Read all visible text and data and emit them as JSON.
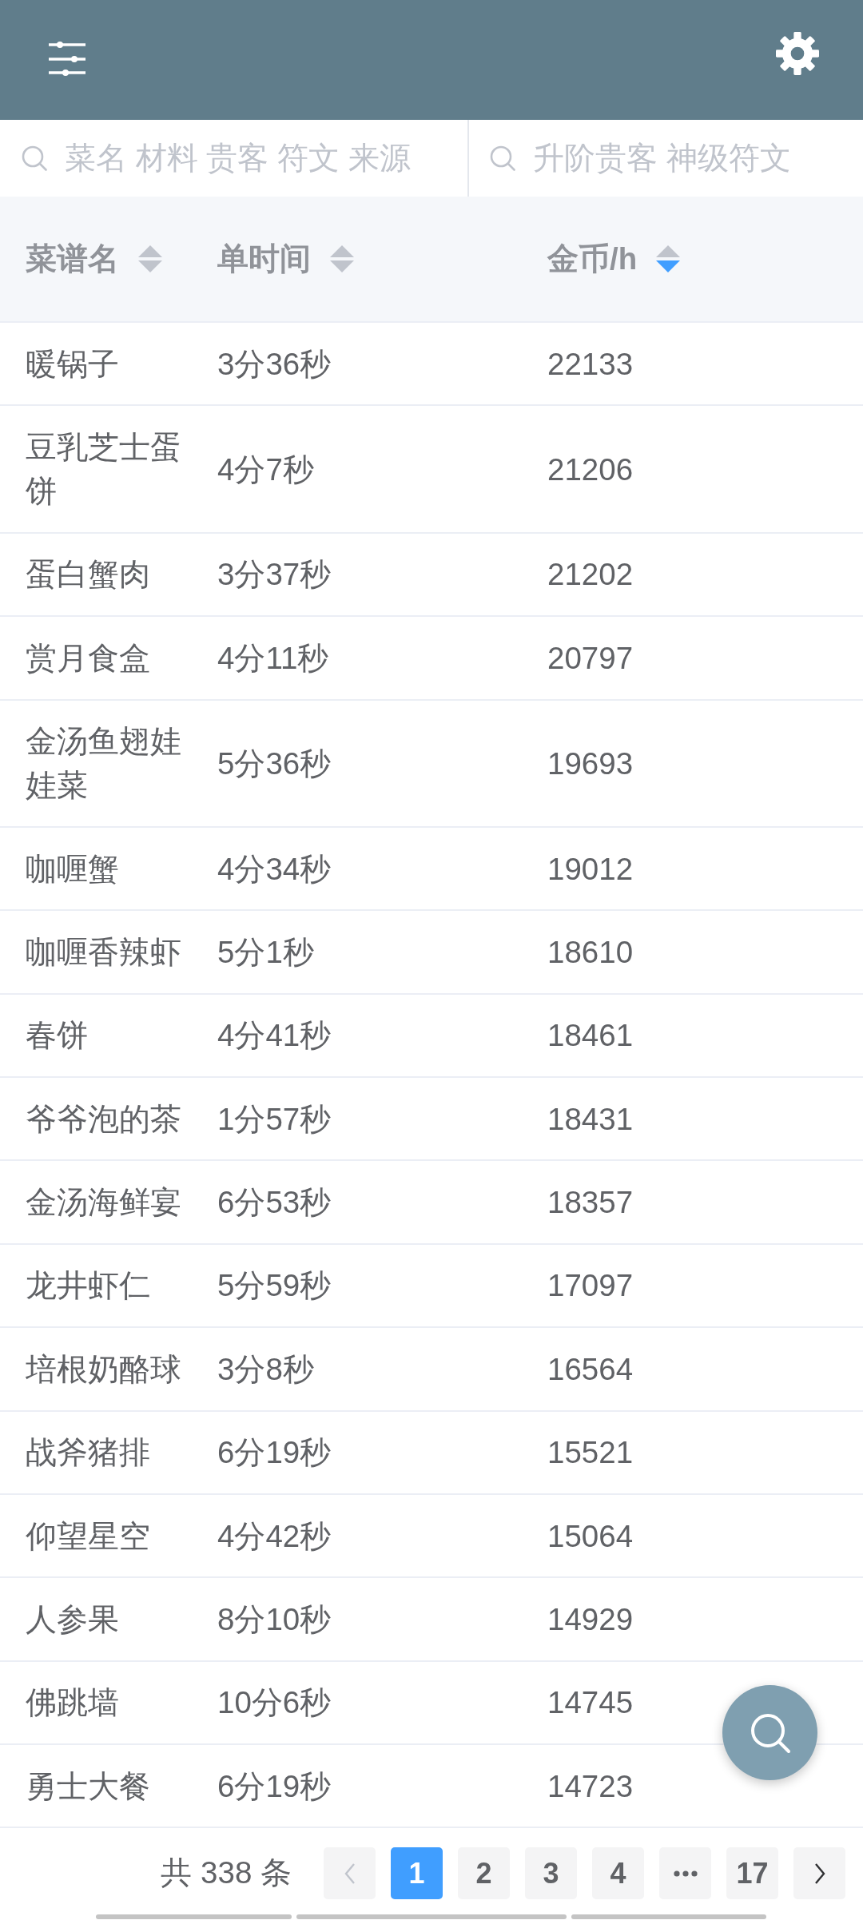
{
  "search_fields": [
    {
      "placeholder": "菜名 材料 贵客 符文 来源"
    },
    {
      "placeholder": "升阶贵客 神级符文"
    }
  ],
  "table": {
    "columns": [
      {
        "label": "菜谱名",
        "sorted_ascending": false,
        "sorted_descending": false
      },
      {
        "label": "单时间",
        "sorted_ascending": false,
        "sorted_descending": false
      },
      {
        "label": "金币/h",
        "sorted_ascending": false,
        "sorted_descending": true
      }
    ],
    "rows": [
      {
        "name": "暖锅子",
        "time": "3分36秒",
        "coins_per_hour": "22133"
      },
      {
        "name": "豆乳芝士蛋饼",
        "time": "4分7秒",
        "coins_per_hour": "21206"
      },
      {
        "name": "蛋白蟹肉",
        "time": "3分37秒",
        "coins_per_hour": "21202"
      },
      {
        "name": "赏月食盒",
        "time": "4分11秒",
        "coins_per_hour": "20797"
      },
      {
        "name": "金汤鱼翅娃娃菜",
        "time": "5分36秒",
        "coins_per_hour": "19693"
      },
      {
        "name": "咖喱蟹",
        "time": "4分34秒",
        "coins_per_hour": "19012"
      },
      {
        "name": "咖喱香辣虾",
        "time": "5分1秒",
        "coins_per_hour": "18610"
      },
      {
        "name": "春饼",
        "time": "4分41秒",
        "coins_per_hour": "18461"
      },
      {
        "name": "爷爷泡的茶",
        "time": "1分57秒",
        "coins_per_hour": "18431"
      },
      {
        "name": "金汤海鲜宴",
        "time": "6分53秒",
        "coins_per_hour": "18357"
      },
      {
        "name": "龙井虾仁",
        "time": "5分59秒",
        "coins_per_hour": "17097"
      },
      {
        "name": "培根奶酪球",
        "time": "3分8秒",
        "coins_per_hour": "16564"
      },
      {
        "name": "战斧猪排",
        "time": "6分19秒",
        "coins_per_hour": "15521"
      },
      {
        "name": "仰望星空",
        "time": "4分42秒",
        "coins_per_hour": "15064"
      },
      {
        "name": "人参果",
        "time": "8分10秒",
        "coins_per_hour": "14929"
      },
      {
        "name": "佛跳墙",
        "time": "10分6秒",
        "coins_per_hour": "14745"
      },
      {
        "name": "勇士大餐",
        "time": "6分19秒",
        "coins_per_hour": "14723"
      }
    ]
  },
  "pagination": {
    "total": "共 338 条",
    "prev": {
      "disabled": true
    },
    "pages": [
      {
        "kind": "page",
        "label": "1",
        "selected": true
      },
      {
        "kind": "page",
        "label": "2",
        "selected": false
      },
      {
        "kind": "page",
        "label": "3",
        "selected": false
      },
      {
        "kind": "page",
        "label": "4",
        "selected": false
      },
      {
        "kind": "more",
        "selected": false
      },
      {
        "kind": "page",
        "label": "17",
        "selected": false
      }
    ],
    "next": {
      "disabled": false
    }
  }
}
